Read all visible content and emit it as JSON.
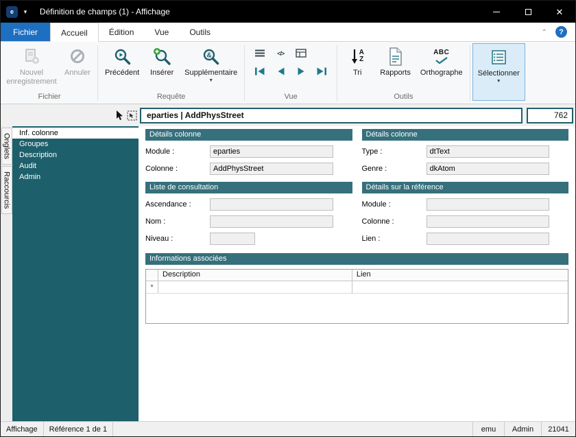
{
  "titlebar": {
    "title": "Définition de champs (1) - Affichage"
  },
  "tabs": {
    "file": "Fichier",
    "home": "Accueil",
    "edit": "Édition",
    "view": "Vue",
    "tools": "Outils"
  },
  "ribbon": {
    "new_record": "Nouvel enregistrement",
    "cancel": "Annuler",
    "previous": "Précédent",
    "insert": "Insérer",
    "supplementary": "Supplémentaire",
    "sort": "Tri",
    "reports": "Rapports",
    "spelling": "Orthographe",
    "select": "Sélectionner",
    "group_file": "Fichier",
    "group_query": "Requête",
    "group_view": "Vue",
    "group_tools": "Outils"
  },
  "record_header": {
    "title": "eparties | AddPhysStreet",
    "count": "762"
  },
  "side_tabs": {
    "tabs": "Onglets",
    "shortcuts": "Raccourcis"
  },
  "sidebar": {
    "items": [
      {
        "label": "Inf. colonne"
      },
      {
        "label": "Groupes"
      },
      {
        "label": "Description"
      },
      {
        "label": "Audit"
      },
      {
        "label": "Admin"
      }
    ]
  },
  "form": {
    "details_left": {
      "title": "Détails colonne",
      "module_label": "Module :",
      "module_value": "eparties",
      "column_label": "Colonne :",
      "column_value": "AddPhysStreet"
    },
    "details_right": {
      "title": "Détails colonne",
      "type_label": "Type :",
      "type_value": "dtText",
      "kind_label": "Genre :",
      "kind_value": "dkAtom"
    },
    "lookup": {
      "title": "Liste de consultation",
      "ancestry_label": "Ascendance :",
      "ancestry_value": "",
      "name_label": "Nom :",
      "name_value": "",
      "level_label": "Niveau :",
      "level_value": ""
    },
    "reference": {
      "title": "Détails sur la référence",
      "module_label": "Module :",
      "module_value": "",
      "column_label": "Colonne :",
      "column_value": "",
      "link_label": "Lien :",
      "link_value": ""
    },
    "associated": {
      "title": "Informations associées",
      "col_description": "Description",
      "col_link": "Lien",
      "row_marker": "*"
    }
  },
  "statusbar": {
    "mode": "Affichage",
    "reference": "Référence 1 de 1",
    "right1": "emu",
    "right2": "Admin",
    "right3": "21041"
  }
}
